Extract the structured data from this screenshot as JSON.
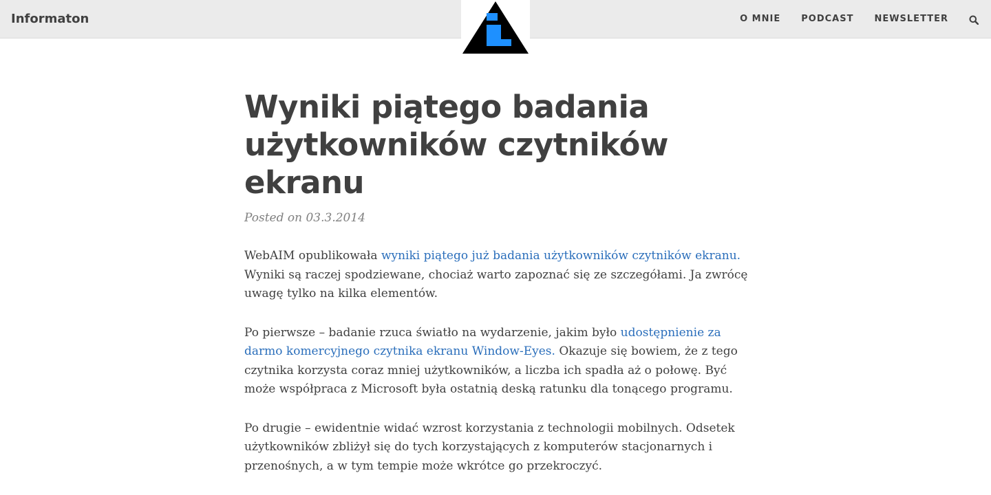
{
  "header": {
    "brand": "Informaton",
    "nav": [
      "O MNIE",
      "PODCAST",
      "NEWSLETTER"
    ],
    "search_icon": "search-icon",
    "logo_icon": "info-triangle-icon"
  },
  "colors": {
    "header_bg": "#ebebeb",
    "text": "#404040",
    "link": "#2a6ebb",
    "logo_blue": "#1e90ff"
  },
  "post": {
    "title_line1": "Wyniki piątego badania",
    "title_line2": "użytkowników czytników",
    "title_line3": "ekranu",
    "meta": "Posted on 03.3.2014",
    "p1_before": "WebAIM opublikowała ",
    "p1_link": "wyniki piątego już badania użytkowników czytników ekranu.",
    "p1_after": " Wyniki są raczej spodziewane, chociaż warto zapoznać się ze szczegółami. Ja zwrócę uwagę tylko na kilka elementów.",
    "p2_before": "Po pierwsze – badanie rzuca światło na wydarzenie, jakim było ",
    "p2_link": "udostępnienie za darmo komercyjnego czytnika ekranu Window-Eyes.",
    "p2_after": " Okazuje się bowiem, że z tego czytnika korzysta coraz mniej użytkowników, a liczba ich spadła aż o połowę. Być może współpraca z Microsoft była ostatnią deską ratunku dla tonącego programu.",
    "p3": "Po drugie – ewidentnie widać wzrost korzystania z technologii mobilnych. Odsetek użytkowników zbliżył się do tych korzystających z komputerów stacjonarnych i przenośnych, a w tym tempie może wkrótce go przekroczyć."
  }
}
